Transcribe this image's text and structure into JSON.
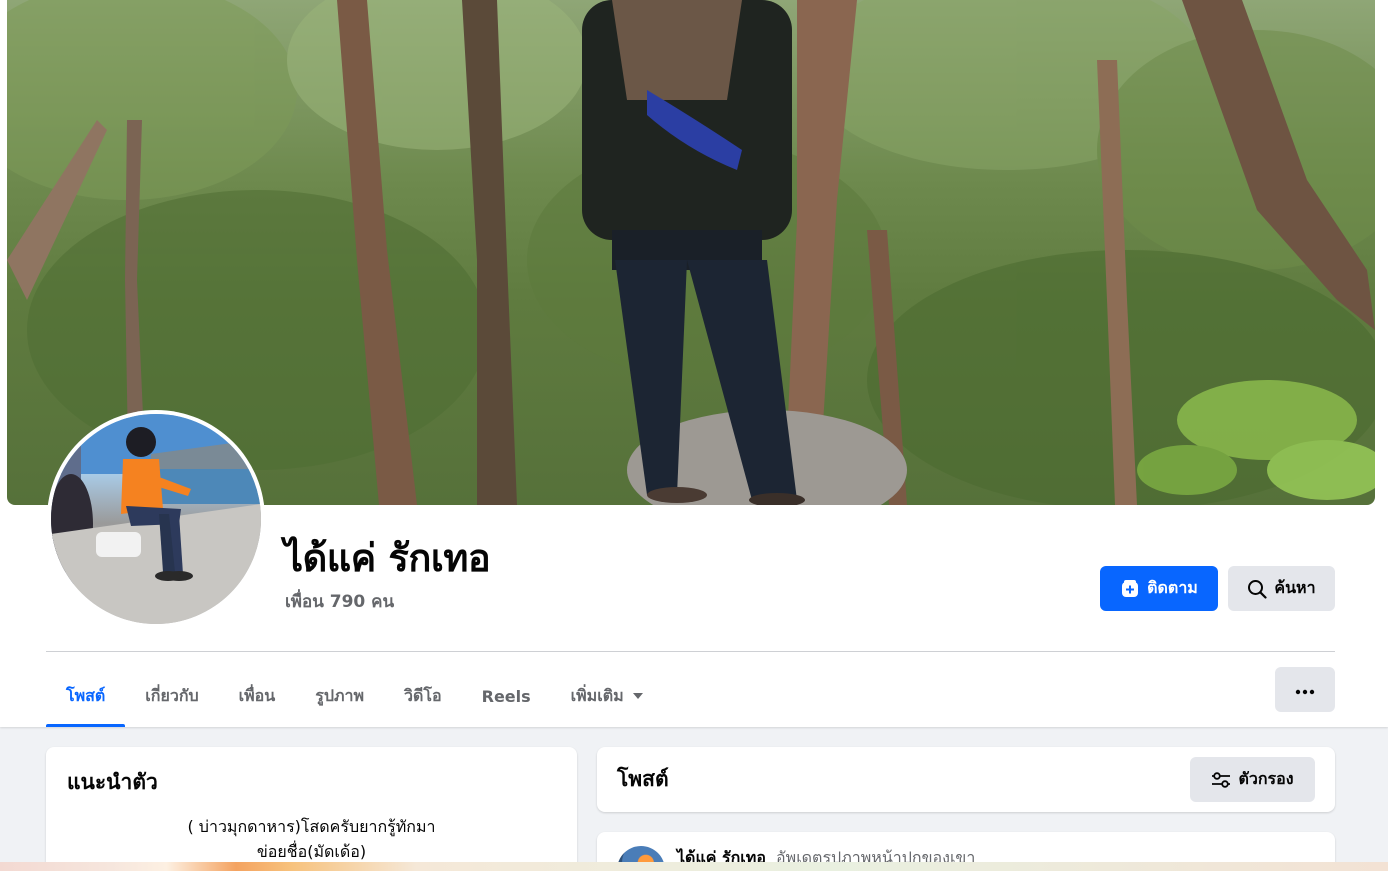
{
  "profile": {
    "name": "ได้แค่ รักเทอ",
    "friends_label": "เพื่อน 790 คน"
  },
  "actions": {
    "follow_label": "ติดตาม",
    "search_label": "ค้นหา"
  },
  "tabs": [
    {
      "label": "โพสต์",
      "active": true
    },
    {
      "label": "เกี่ยวกับ",
      "active": false
    },
    {
      "label": "เพื่อน",
      "active": false
    },
    {
      "label": "รูปภาพ",
      "active": false
    },
    {
      "label": "วิดีโอ",
      "active": false
    },
    {
      "label": "Reels",
      "active": false
    },
    {
      "label": "เพิ่มเติม",
      "active": false
    }
  ],
  "intro": {
    "title": "แนะนำตัว",
    "bio_line_1": "( บ่าวมุกดาหาร)โสดครับยากรู้ทักมา",
    "bio_line_2": "ข่อยชื่อ(มัดเด้อ)"
  },
  "posts": {
    "title": "โพสต์",
    "filter_label": "ตัวกรอง"
  },
  "first_post": {
    "author": "ได้แค่ รักเทอ",
    "action": "อัพเดตรูปภาพหน้าปกของเขา"
  },
  "icons": {
    "follow": "follow-plus-icon",
    "search": "search-icon",
    "more": "more-dots-icon",
    "dropdown": "chevron-down-icon",
    "filter": "filter-sliders-icon"
  },
  "colors": {
    "accent": "#0866ff",
    "secondary_button": "#e4e6eb",
    "muted_text": "#65676b",
    "page_background": "#f0f2f5"
  }
}
